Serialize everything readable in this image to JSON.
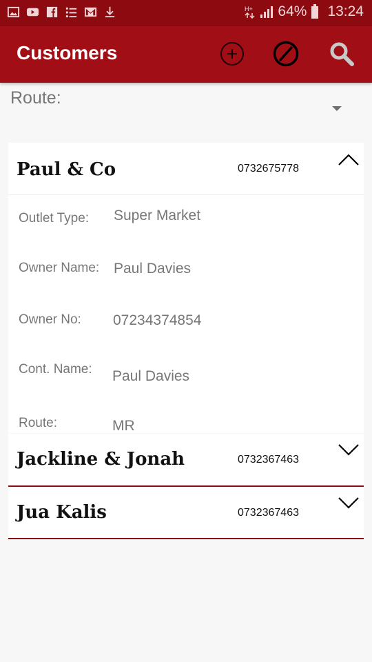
{
  "status_bar": {
    "battery": "64%",
    "time": "13:24",
    "left_icons": [
      "gallery-icon",
      "youtube-icon",
      "facebook-icon",
      "list-icon",
      "gmail-icon",
      "download-icon"
    ],
    "right_icons": [
      "data-arrows-icon",
      "signal-icon",
      "battery-icon"
    ]
  },
  "app_bar": {
    "title": "Customers",
    "actions": [
      "add-icon",
      "block-icon",
      "search-icon"
    ]
  },
  "route_filter": {
    "label": "Route:",
    "selected": ""
  },
  "customers": [
    {
      "name": "Paul & Co",
      "phone": "0732675778",
      "expanded": true,
      "details": [
        {
          "label": "Outlet Type:",
          "value": "Super Market"
        },
        {
          "label": "Owner Name:",
          "value": "Paul Davies"
        },
        {
          "label": "Owner No:",
          "value": "07234374854"
        },
        {
          "label": "Cont. Name:",
          "value": "Paul Davies"
        },
        {
          "label": "Route:",
          "value": "MR"
        }
      ]
    },
    {
      "name": "Jackline & Jonah",
      "phone": "0732367463",
      "expanded": false
    },
    {
      "name": "Jua Kalis",
      "phone": "0732367463",
      "expanded": false
    }
  ],
  "colors": {
    "status_bar": "#8d0a11",
    "app_bar": "#a20e16",
    "accent": "#8d0a11",
    "background": "#f7f7f7"
  }
}
